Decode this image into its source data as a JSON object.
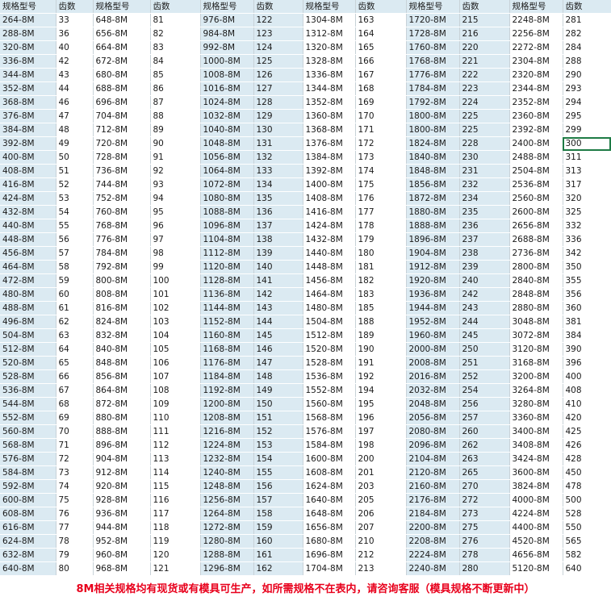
{
  "header": {
    "spec": "规格型号",
    "teeth": "齿数"
  },
  "footer": "8M相关规格均有现货或有模具可生产，如所需规格不在表内，请咨询客服（模具规格不断更新中）",
  "selected_cell": "300",
  "columns": [
    [
      [
        "264-8M",
        "33"
      ],
      [
        "288-8M",
        "36"
      ],
      [
        "320-8M",
        "40"
      ],
      [
        "336-8M",
        "42"
      ],
      [
        "344-8M",
        "43"
      ],
      [
        "352-8M",
        "44"
      ],
      [
        "368-8M",
        "46"
      ],
      [
        "376-8M",
        "47"
      ],
      [
        "384-8M",
        "48"
      ],
      [
        "392-8M",
        "49"
      ],
      [
        "400-8M",
        "50"
      ],
      [
        "408-8M",
        "51"
      ],
      [
        "416-8M",
        "52"
      ],
      [
        "424-8M",
        "53"
      ],
      [
        "432-8M",
        "54"
      ],
      [
        "440-8M",
        "55"
      ],
      [
        "448-8M",
        "56"
      ],
      [
        "456-8M",
        "57"
      ],
      [
        "464-8M",
        "58"
      ],
      [
        "472-8M",
        "59"
      ],
      [
        "480-8M",
        "60"
      ],
      [
        "488-8M",
        "61"
      ],
      [
        "496-8M",
        "62"
      ],
      [
        "504-8M",
        "63"
      ],
      [
        "512-8M",
        "64"
      ],
      [
        "520-8M",
        "65"
      ],
      [
        "528-8M",
        "66"
      ],
      [
        "536-8M",
        "67"
      ],
      [
        "544-8M",
        "68"
      ],
      [
        "552-8M",
        "69"
      ],
      [
        "560-8M",
        "70"
      ],
      [
        "568-8M",
        "71"
      ],
      [
        "576-8M",
        "72"
      ],
      [
        "584-8M",
        "73"
      ],
      [
        "592-8M",
        "74"
      ],
      [
        "600-8M",
        "75"
      ],
      [
        "608-8M",
        "76"
      ],
      [
        "616-8M",
        "77"
      ],
      [
        "624-8M",
        "78"
      ],
      [
        "632-8M",
        "79"
      ],
      [
        "640-8M",
        "80"
      ]
    ],
    [
      [
        "648-8M",
        "81"
      ],
      [
        "656-8M",
        "82"
      ],
      [
        "664-8M",
        "83"
      ],
      [
        "672-8M",
        "84"
      ],
      [
        "680-8M",
        "85"
      ],
      [
        "688-8M",
        "86"
      ],
      [
        "696-8M",
        "87"
      ],
      [
        "704-8M",
        "88"
      ],
      [
        "712-8M",
        "89"
      ],
      [
        "720-8M",
        "90"
      ],
      [
        "728-8M",
        "91"
      ],
      [
        "736-8M",
        "92"
      ],
      [
        "744-8M",
        "93"
      ],
      [
        "752-8M",
        "94"
      ],
      [
        "760-8M",
        "95"
      ],
      [
        "768-8M",
        "96"
      ],
      [
        "776-8M",
        "97"
      ],
      [
        "784-8M",
        "98"
      ],
      [
        "792-8M",
        "99"
      ],
      [
        "800-8M",
        "100"
      ],
      [
        "808-8M",
        "101"
      ],
      [
        "816-8M",
        "102"
      ],
      [
        "824-8M",
        "103"
      ],
      [
        "832-8M",
        "104"
      ],
      [
        "840-8M",
        "105"
      ],
      [
        "848-8M",
        "106"
      ],
      [
        "856-8M",
        "107"
      ],
      [
        "864-8M",
        "108"
      ],
      [
        "872-8M",
        "109"
      ],
      [
        "880-8M",
        "110"
      ],
      [
        "888-8M",
        "111"
      ],
      [
        "896-8M",
        "112"
      ],
      [
        "904-8M",
        "113"
      ],
      [
        "912-8M",
        "114"
      ],
      [
        "920-8M",
        "115"
      ],
      [
        "928-8M",
        "116"
      ],
      [
        "936-8M",
        "117"
      ],
      [
        "944-8M",
        "118"
      ],
      [
        "952-8M",
        "119"
      ],
      [
        "960-8M",
        "120"
      ],
      [
        "968-8M",
        "121"
      ]
    ],
    [
      [
        "976-8M",
        "122"
      ],
      [
        "984-8M",
        "123"
      ],
      [
        "992-8M",
        "124"
      ],
      [
        "1000-8M",
        "125"
      ],
      [
        "1008-8M",
        "126"
      ],
      [
        "1016-8M",
        "127"
      ],
      [
        "1024-8M",
        "128"
      ],
      [
        "1032-8M",
        "129"
      ],
      [
        "1040-8M",
        "130"
      ],
      [
        "1048-8M",
        "131"
      ],
      [
        "1056-8M",
        "132"
      ],
      [
        "1064-8M",
        "133"
      ],
      [
        "1072-8M",
        "134"
      ],
      [
        "1080-8M",
        "135"
      ],
      [
        "1088-8M",
        "136"
      ],
      [
        "1096-8M",
        "137"
      ],
      [
        "1104-8M",
        "138"
      ],
      [
        "1112-8M",
        "139"
      ],
      [
        "1120-8M",
        "140"
      ],
      [
        "1128-8M",
        "141"
      ],
      [
        "1136-8M",
        "142"
      ],
      [
        "1144-8M",
        "143"
      ],
      [
        "1152-8M",
        "144"
      ],
      [
        "1160-8M",
        "145"
      ],
      [
        "1168-8M",
        "146"
      ],
      [
        "1176-8M",
        "147"
      ],
      [
        "1184-8M",
        "148"
      ],
      [
        "1192-8M",
        "149"
      ],
      [
        "1200-8M",
        "150"
      ],
      [
        "1208-8M",
        "151"
      ],
      [
        "1216-8M",
        "152"
      ],
      [
        "1224-8M",
        "153"
      ],
      [
        "1232-8M",
        "154"
      ],
      [
        "1240-8M",
        "155"
      ],
      [
        "1248-8M",
        "156"
      ],
      [
        "1256-8M",
        "157"
      ],
      [
        "1264-8M",
        "158"
      ],
      [
        "1272-8M",
        "159"
      ],
      [
        "1280-8M",
        "160"
      ],
      [
        "1288-8M",
        "161"
      ],
      [
        "1296-8M",
        "162"
      ]
    ],
    [
      [
        "1304-8M",
        "163"
      ],
      [
        "1312-8M",
        "164"
      ],
      [
        "1320-8M",
        "165"
      ],
      [
        "1328-8M",
        "166"
      ],
      [
        "1336-8M",
        "167"
      ],
      [
        "1344-8M",
        "168"
      ],
      [
        "1352-8M",
        "169"
      ],
      [
        "1360-8M",
        "170"
      ],
      [
        "1368-8M",
        "171"
      ],
      [
        "1376-8M",
        "172"
      ],
      [
        "1384-8M",
        "173"
      ],
      [
        "1392-8M",
        "174"
      ],
      [
        "1400-8M",
        "175"
      ],
      [
        "1408-8M",
        "176"
      ],
      [
        "1416-8M",
        "177"
      ],
      [
        "1424-8M",
        "178"
      ],
      [
        "1432-8M",
        "179"
      ],
      [
        "1440-8M",
        "180"
      ],
      [
        "1448-8M",
        "181"
      ],
      [
        "1456-8M",
        "182"
      ],
      [
        "1464-8M",
        "183"
      ],
      [
        "1480-8M",
        "185"
      ],
      [
        "1504-8M",
        "188"
      ],
      [
        "1512-8M",
        "189"
      ],
      [
        "1520-8M",
        "190"
      ],
      [
        "1528-8M",
        "191"
      ],
      [
        "1536-8M",
        "192"
      ],
      [
        "1552-8M",
        "194"
      ],
      [
        "1560-8M",
        "195"
      ],
      [
        "1568-8M",
        "196"
      ],
      [
        "1576-8M",
        "197"
      ],
      [
        "1584-8M",
        "198"
      ],
      [
        "1600-8M",
        "200"
      ],
      [
        "1608-8M",
        "201"
      ],
      [
        "1624-8M",
        "203"
      ],
      [
        "1640-8M",
        "205"
      ],
      [
        "1648-8M",
        "206"
      ],
      [
        "1656-8M",
        "207"
      ],
      [
        "1680-8M",
        "210"
      ],
      [
        "1696-8M",
        "212"
      ],
      [
        "1704-8M",
        "213"
      ]
    ],
    [
      [
        "1720-8M",
        "215"
      ],
      [
        "1728-8M",
        "216"
      ],
      [
        "1760-8M",
        "220"
      ],
      [
        "1768-8M",
        "221"
      ],
      [
        "1776-8M",
        "222"
      ],
      [
        "1784-8M",
        "223"
      ],
      [
        "1792-8M",
        "224"
      ],
      [
        "1800-8M",
        "225"
      ],
      [
        "1800-8M",
        "225"
      ],
      [
        "1824-8M",
        "228"
      ],
      [
        "1840-8M",
        "230"
      ],
      [
        "1848-8M",
        "231"
      ],
      [
        "1856-8M",
        "232"
      ],
      [
        "1872-8M",
        "234"
      ],
      [
        "1880-8M",
        "235"
      ],
      [
        "1888-8M",
        "236"
      ],
      [
        "1896-8M",
        "237"
      ],
      [
        "1904-8M",
        "238"
      ],
      [
        "1912-8M",
        "239"
      ],
      [
        "1920-8M",
        "240"
      ],
      [
        "1936-8M",
        "242"
      ],
      [
        "1944-8M",
        "243"
      ],
      [
        "1952-8M",
        "244"
      ],
      [
        "1960-8M",
        "245"
      ],
      [
        "2000-8M",
        "250"
      ],
      [
        "2008-8M",
        "251"
      ],
      [
        "2016-8M",
        "252"
      ],
      [
        "2032-8M",
        "254"
      ],
      [
        "2048-8M",
        "256"
      ],
      [
        "2056-8M",
        "257"
      ],
      [
        "2080-8M",
        "260"
      ],
      [
        "2096-8M",
        "262"
      ],
      [
        "2104-8M",
        "263"
      ],
      [
        "2120-8M",
        "265"
      ],
      [
        "2160-8M",
        "270"
      ],
      [
        "2176-8M",
        "272"
      ],
      [
        "2184-8M",
        "273"
      ],
      [
        "2200-8M",
        "275"
      ],
      [
        "2208-8M",
        "276"
      ],
      [
        "2224-8M",
        "278"
      ],
      [
        "2240-8M",
        "280"
      ]
    ],
    [
      [
        "2248-8M",
        "281"
      ],
      [
        "2256-8M",
        "282"
      ],
      [
        "2272-8M",
        "284"
      ],
      [
        "2304-8M",
        "288"
      ],
      [
        "2320-8M",
        "290"
      ],
      [
        "2344-8M",
        "293"
      ],
      [
        "2352-8M",
        "294"
      ],
      [
        "2360-8M",
        "295"
      ],
      [
        "2392-8M",
        "299"
      ],
      [
        "2400-8M",
        "300"
      ],
      [
        "2488-8M",
        "311"
      ],
      [
        "2504-8M",
        "313"
      ],
      [
        "2536-8M",
        "317"
      ],
      [
        "2560-8M",
        "320"
      ],
      [
        "2600-8M",
        "325"
      ],
      [
        "2656-8M",
        "332"
      ],
      [
        "2688-8M",
        "336"
      ],
      [
        "2736-8M",
        "342"
      ],
      [
        "2800-8M",
        "350"
      ],
      [
        "2840-8M",
        "355"
      ],
      [
        "2848-8M",
        "356"
      ],
      [
        "2880-8M",
        "360"
      ],
      [
        "3048-8M",
        "381"
      ],
      [
        "3072-8M",
        "384"
      ],
      [
        "3120-8M",
        "390"
      ],
      [
        "3168-8M",
        "396"
      ],
      [
        "3200-8M",
        "400"
      ],
      [
        "3264-8M",
        "408"
      ],
      [
        "3280-8M",
        "410"
      ],
      [
        "3360-8M",
        "420"
      ],
      [
        "3400-8M",
        "425"
      ],
      [
        "3408-8M",
        "426"
      ],
      [
        "3424-8M",
        "428"
      ],
      [
        "3600-8M",
        "450"
      ],
      [
        "3824-8M",
        "478"
      ],
      [
        "4000-8M",
        "500"
      ],
      [
        "4224-8M",
        "528"
      ],
      [
        "4400-8M",
        "550"
      ],
      [
        "4520-8M",
        "565"
      ],
      [
        "4656-8M",
        "582"
      ],
      [
        "5120-8M",
        "640"
      ]
    ]
  ]
}
